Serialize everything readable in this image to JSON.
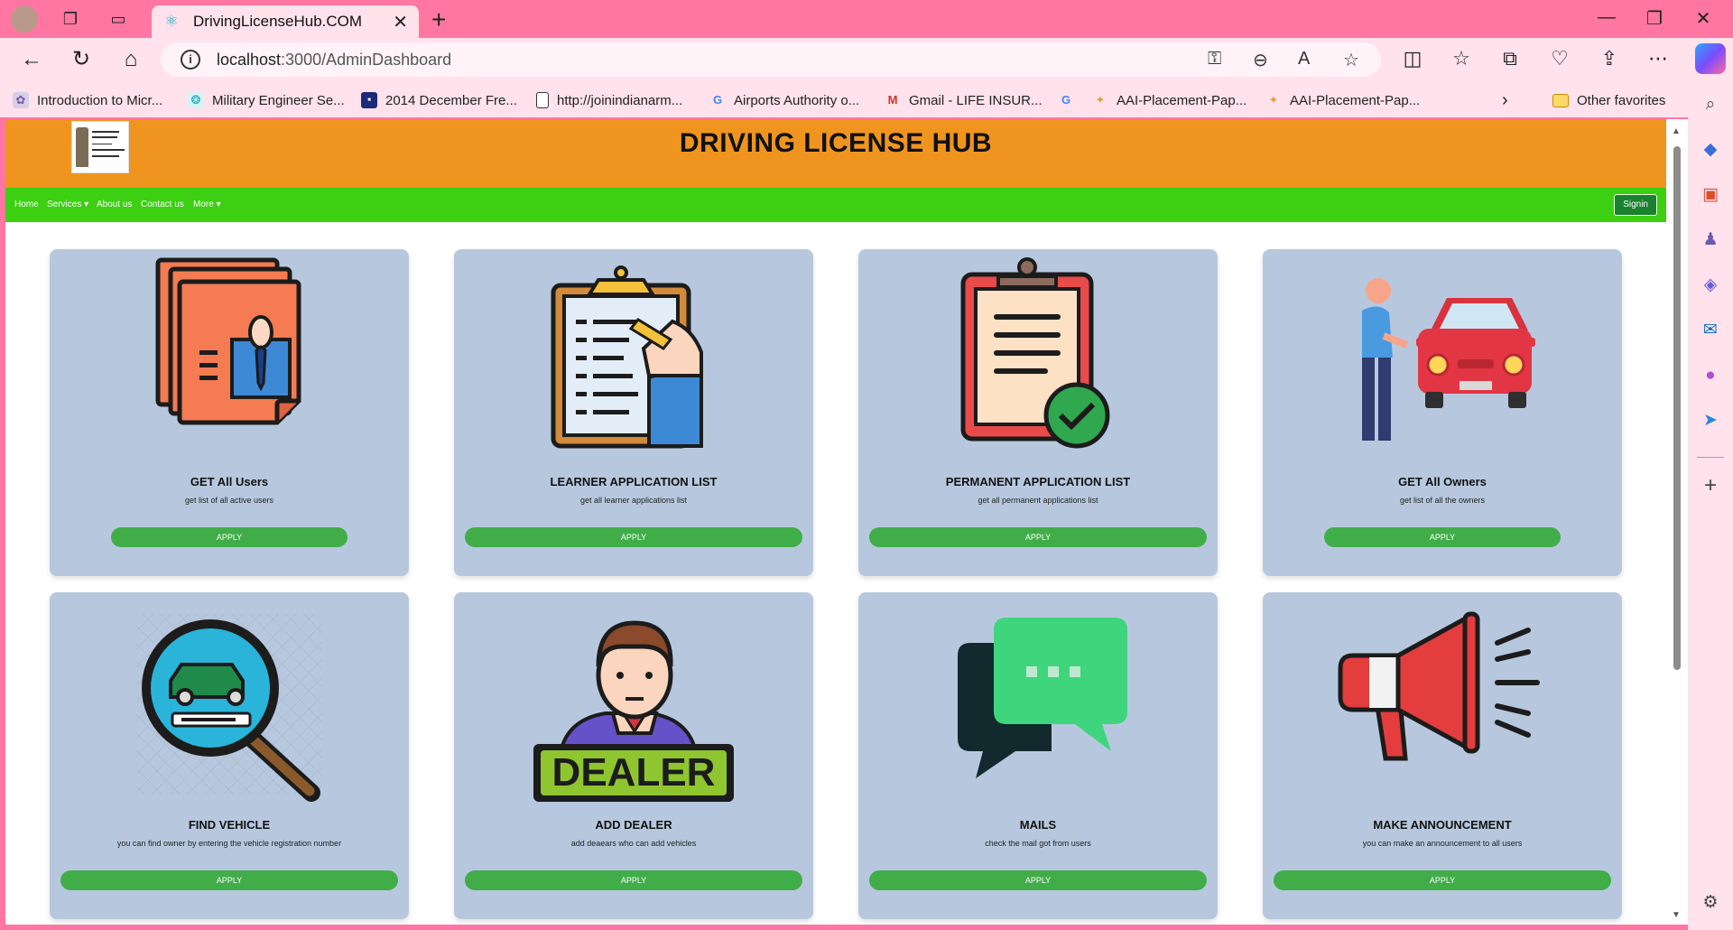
{
  "browser": {
    "tab_title": "DrivingLicenseHub.COM",
    "url_host": "localhost",
    "url_path": ":3000/AdminDashboard",
    "favorites": [
      "Introduction to Micr...",
      "Military Engineer Se...",
      "2014 December Fre...",
      "http://joinindianarm...",
      "Airports Authority o...",
      "Gmail - LIFE INSUR...",
      "AAI-Placement-Pap...",
      "AAI-Placement-Pap...",
      "Other favorites"
    ],
    "accent": "#ff76a3",
    "chrome_bg": "#ffe2ec"
  },
  "site": {
    "title": "DRIVING LICENSE HUB",
    "logo_lines": [
      "सड़क परिवहन",
      "और राजमार्ग",
      "MINISTRY OF",
      "ROAD TRANSPORT",
      "AND HIGHWAYS"
    ],
    "nav": [
      "Home",
      "Services",
      "About us",
      "Contact us",
      "More"
    ],
    "signin_label": "Signin",
    "header_color": "#ef951f",
    "nav_color": "#3ccf12"
  },
  "cards": [
    {
      "title": "GET All Users",
      "desc": "get list of all active users",
      "button": "APPLY",
      "icon": "user-documents-icon"
    },
    {
      "title": "LEARNER APPLICATION LIST",
      "desc": "get all learner applications list",
      "button": "APPLY",
      "icon": "clipboard-writing-icon"
    },
    {
      "title": "PERMANENT APPLICATION LIST",
      "desc": "get all permanent applications list",
      "button": "APPLY",
      "icon": "clipboard-check-icon"
    },
    {
      "title": "GET All Owners",
      "desc": "get list of all the owners",
      "button": "APPLY",
      "icon": "car-owner-icon"
    },
    {
      "title": "FIND VEHICLE",
      "desc": "you can find owner by entering the vehicle registration number",
      "button": "APPLY",
      "icon": "vehicle-search-icon"
    },
    {
      "title": "ADD DEALER",
      "desc": "add deaears who can add vehicles",
      "button": "APPLY",
      "icon": "dealer-icon"
    },
    {
      "title": "MAILS",
      "desc": "check the mail got from users",
      "button": "APPLY",
      "icon": "chat-bubbles-icon"
    },
    {
      "title": "MAKE ANNOUNCEMENT",
      "desc": "you can make an announcement to all users",
      "button": "APPLY",
      "icon": "megaphone-icon"
    }
  ],
  "dealer_sign_text": "DEALER"
}
